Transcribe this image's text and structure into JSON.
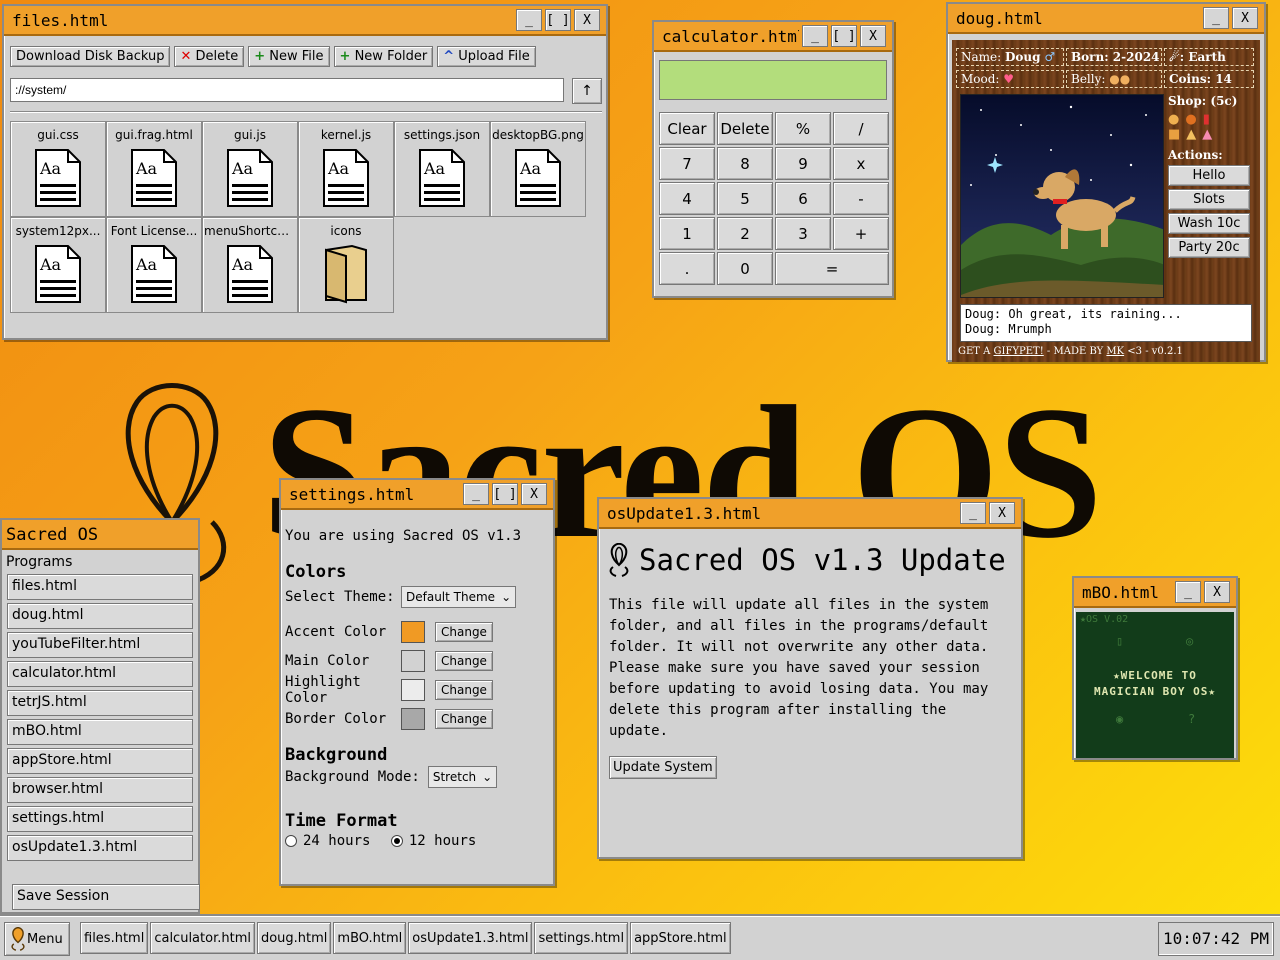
{
  "desktop": {
    "brand_text": "Sacred OS"
  },
  "files": {
    "title": "files.html",
    "toolbar": {
      "backup": "Download Disk Backup",
      "delete": "Delete",
      "new_file": "New File",
      "new_folder": "New Folder",
      "upload": "Upload File"
    },
    "path": "://system/",
    "up_label": "↑",
    "items": [
      "gui.css",
      "gui.frag.html",
      "gui.js",
      "kernel.js",
      "settings.json",
      "desktopBG.png",
      "system12px...",
      "Font License...",
      "menuShortcu...",
      "icons"
    ],
    "icon_text": "Aa"
  },
  "window_buttons": {
    "minimize": "_",
    "maximize": "[ ]",
    "close": "X"
  },
  "calculator": {
    "title": "calculator.html",
    "display": "",
    "keys": [
      "Clear",
      "Delete",
      "%",
      "/",
      "7",
      "8",
      "9",
      "x",
      "4",
      "5",
      "6",
      "-",
      "1",
      "2",
      "3",
      "+",
      ".",
      "0",
      "="
    ]
  },
  "doug": {
    "title": "doug.html",
    "name_label": "Name:",
    "name": "Doug",
    "born": "Born: 2-2024",
    "planet": ": Earth",
    "mood_label": "Mood:",
    "belly_label": "Belly:",
    "coins": "Coins: 14",
    "shop_label": "Shop: (5c)",
    "actions_label": "Actions:",
    "actions": [
      "Hello",
      "Slots",
      "Wash 10c",
      "Party 20c"
    ],
    "log": [
      "Doug: Oh great, its raining...",
      "Doug: Mrumph"
    ],
    "footer_get": "GET A ",
    "footer_link": "GIFYPET!",
    "footer_mid": " - MADE BY ",
    "footer_mk": "MK",
    "footer_end": " <3 - v0.2.1"
  },
  "settings": {
    "title": "settings.html",
    "version_text": "You are using Sacred OS v1.3",
    "colors_heading": "Colors",
    "theme_label": "Select Theme:",
    "theme_value": "Default Theme",
    "color_rows": [
      {
        "label": "Accent Color",
        "color": "#f09a24"
      },
      {
        "label": "Main Color",
        "color": "#d2d2d2"
      },
      {
        "label": "Highlight Color",
        "color": "#ececec"
      },
      {
        "label": "Border Color",
        "color": "#a8a8a8"
      }
    ],
    "change_label": "Change",
    "background_heading": "Background",
    "bg_mode_label": "Background Mode:",
    "bg_mode_value": "Stretch",
    "time_heading": "Time Format",
    "time_24": "24 hours",
    "time_12": "12 hours"
  },
  "update": {
    "title": "osUpdate1.3.html",
    "heading": "Sacred OS v1.3 Update",
    "body": "This file will update all files in the system folder, and all files in the programs/default folder. It will not overwrite any other data. Please make sure you have saved your session before updating to avoid losing data. You may delete this program after installing the update.",
    "button": "Update System"
  },
  "mbo": {
    "title": "mBO.html",
    "os_label": "★OS V.02",
    "welcome_1": "★WELCOME TO",
    "welcome_2": "MAGICIAN BOY OS★"
  },
  "startmenu": {
    "title": "Sacred OS",
    "category": "Programs",
    "items": [
      "files.html",
      "doug.html",
      "youTubeFilter.html",
      "calculator.html",
      "tetrJS.html",
      "mBO.html",
      "appStore.html",
      "browser.html",
      "settings.html",
      "osUpdate1.3.html"
    ],
    "save": "Save Session"
  },
  "taskbar": {
    "menu": "Menu",
    "tasks": [
      "files.html",
      "calculator.html",
      "doug.html",
      "mBO.html",
      "osUpdate1.3.html",
      "settings.html",
      "appStore.html"
    ],
    "clock": "10:07:42 PM"
  },
  "colors": {
    "accent": "#f0a02a",
    "calc_display": "#b3dd7c"
  }
}
